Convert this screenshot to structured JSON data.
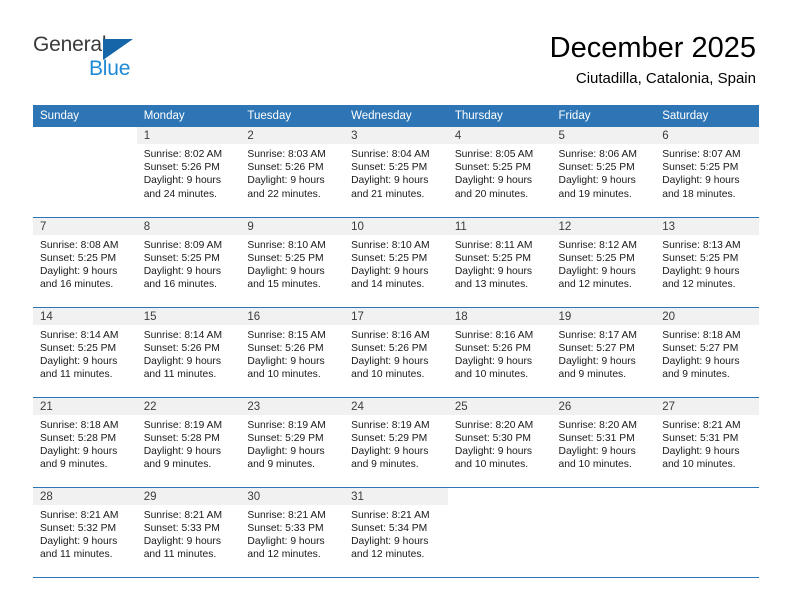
{
  "brand": {
    "name_part1": "General",
    "name_part2": "Blue",
    "triangle_icon": "triangle-icon",
    "accent_dark": "#1565a8",
    "accent_light": "#1f8ad6"
  },
  "header": {
    "month_title": "December 2025",
    "location": "Ciutadilla, Catalonia, Spain"
  },
  "theme": {
    "header_blue": "#2e75b6",
    "daynum_band": "#f1f1f1",
    "text": "#000000"
  },
  "weekday_headers": [
    "Sunday",
    "Monday",
    "Tuesday",
    "Wednesday",
    "Thursday",
    "Friday",
    "Saturday"
  ],
  "calendar": {
    "weeks": [
      [
        {
          "day": "",
          "sunrise": "",
          "sunset": "",
          "daylight_line1": "",
          "daylight_line2": "",
          "empty": true
        },
        {
          "day": "1",
          "sunrise": "Sunrise: 8:02 AM",
          "sunset": "Sunset: 5:26 PM",
          "daylight_line1": "Daylight: 9 hours",
          "daylight_line2": "and 24 minutes.",
          "empty": false
        },
        {
          "day": "2",
          "sunrise": "Sunrise: 8:03 AM",
          "sunset": "Sunset: 5:26 PM",
          "daylight_line1": "Daylight: 9 hours",
          "daylight_line2": "and 22 minutes.",
          "empty": false
        },
        {
          "day": "3",
          "sunrise": "Sunrise: 8:04 AM",
          "sunset": "Sunset: 5:25 PM",
          "daylight_line1": "Daylight: 9 hours",
          "daylight_line2": "and 21 minutes.",
          "empty": false
        },
        {
          "day": "4",
          "sunrise": "Sunrise: 8:05 AM",
          "sunset": "Sunset: 5:25 PM",
          "daylight_line1": "Daylight: 9 hours",
          "daylight_line2": "and 20 minutes.",
          "empty": false
        },
        {
          "day": "5",
          "sunrise": "Sunrise: 8:06 AM",
          "sunset": "Sunset: 5:25 PM",
          "daylight_line1": "Daylight: 9 hours",
          "daylight_line2": "and 19 minutes.",
          "empty": false
        },
        {
          "day": "6",
          "sunrise": "Sunrise: 8:07 AM",
          "sunset": "Sunset: 5:25 PM",
          "daylight_line1": "Daylight: 9 hours",
          "daylight_line2": "and 18 minutes.",
          "empty": false
        }
      ],
      [
        {
          "day": "7",
          "sunrise": "Sunrise: 8:08 AM",
          "sunset": "Sunset: 5:25 PM",
          "daylight_line1": "Daylight: 9 hours",
          "daylight_line2": "and 16 minutes.",
          "empty": false
        },
        {
          "day": "8",
          "sunrise": "Sunrise: 8:09 AM",
          "sunset": "Sunset: 5:25 PM",
          "daylight_line1": "Daylight: 9 hours",
          "daylight_line2": "and 16 minutes.",
          "empty": false
        },
        {
          "day": "9",
          "sunrise": "Sunrise: 8:10 AM",
          "sunset": "Sunset: 5:25 PM",
          "daylight_line1": "Daylight: 9 hours",
          "daylight_line2": "and 15 minutes.",
          "empty": false
        },
        {
          "day": "10",
          "sunrise": "Sunrise: 8:10 AM",
          "sunset": "Sunset: 5:25 PM",
          "daylight_line1": "Daylight: 9 hours",
          "daylight_line2": "and 14 minutes.",
          "empty": false
        },
        {
          "day": "11",
          "sunrise": "Sunrise: 8:11 AM",
          "sunset": "Sunset: 5:25 PM",
          "daylight_line1": "Daylight: 9 hours",
          "daylight_line2": "and 13 minutes.",
          "empty": false
        },
        {
          "day": "12",
          "sunrise": "Sunrise: 8:12 AM",
          "sunset": "Sunset: 5:25 PM",
          "daylight_line1": "Daylight: 9 hours",
          "daylight_line2": "and 12 minutes.",
          "empty": false
        },
        {
          "day": "13",
          "sunrise": "Sunrise: 8:13 AM",
          "sunset": "Sunset: 5:25 PM",
          "daylight_line1": "Daylight: 9 hours",
          "daylight_line2": "and 12 minutes.",
          "empty": false
        }
      ],
      [
        {
          "day": "14",
          "sunrise": "Sunrise: 8:14 AM",
          "sunset": "Sunset: 5:25 PM",
          "daylight_line1": "Daylight: 9 hours",
          "daylight_line2": "and 11 minutes.",
          "empty": false
        },
        {
          "day": "15",
          "sunrise": "Sunrise: 8:14 AM",
          "sunset": "Sunset: 5:26 PM",
          "daylight_line1": "Daylight: 9 hours",
          "daylight_line2": "and 11 minutes.",
          "empty": false
        },
        {
          "day": "16",
          "sunrise": "Sunrise: 8:15 AM",
          "sunset": "Sunset: 5:26 PM",
          "daylight_line1": "Daylight: 9 hours",
          "daylight_line2": "and 10 minutes.",
          "empty": false
        },
        {
          "day": "17",
          "sunrise": "Sunrise: 8:16 AM",
          "sunset": "Sunset: 5:26 PM",
          "daylight_line1": "Daylight: 9 hours",
          "daylight_line2": "and 10 minutes.",
          "empty": false
        },
        {
          "day": "18",
          "sunrise": "Sunrise: 8:16 AM",
          "sunset": "Sunset: 5:26 PM",
          "daylight_line1": "Daylight: 9 hours",
          "daylight_line2": "and 10 minutes.",
          "empty": false
        },
        {
          "day": "19",
          "sunrise": "Sunrise: 8:17 AM",
          "sunset": "Sunset: 5:27 PM",
          "daylight_line1": "Daylight: 9 hours",
          "daylight_line2": "and 9 minutes.",
          "empty": false
        },
        {
          "day": "20",
          "sunrise": "Sunrise: 8:18 AM",
          "sunset": "Sunset: 5:27 PM",
          "daylight_line1": "Daylight: 9 hours",
          "daylight_line2": "and 9 minutes.",
          "empty": false
        }
      ],
      [
        {
          "day": "21",
          "sunrise": "Sunrise: 8:18 AM",
          "sunset": "Sunset: 5:28 PM",
          "daylight_line1": "Daylight: 9 hours",
          "daylight_line2": "and 9 minutes.",
          "empty": false
        },
        {
          "day": "22",
          "sunrise": "Sunrise: 8:19 AM",
          "sunset": "Sunset: 5:28 PM",
          "daylight_line1": "Daylight: 9 hours",
          "daylight_line2": "and 9 minutes.",
          "empty": false
        },
        {
          "day": "23",
          "sunrise": "Sunrise: 8:19 AM",
          "sunset": "Sunset: 5:29 PM",
          "daylight_line1": "Daylight: 9 hours",
          "daylight_line2": "and 9 minutes.",
          "empty": false
        },
        {
          "day": "24",
          "sunrise": "Sunrise: 8:19 AM",
          "sunset": "Sunset: 5:29 PM",
          "daylight_line1": "Daylight: 9 hours",
          "daylight_line2": "and 9 minutes.",
          "empty": false
        },
        {
          "day": "25",
          "sunrise": "Sunrise: 8:20 AM",
          "sunset": "Sunset: 5:30 PM",
          "daylight_line1": "Daylight: 9 hours",
          "daylight_line2": "and 10 minutes.",
          "empty": false
        },
        {
          "day": "26",
          "sunrise": "Sunrise: 8:20 AM",
          "sunset": "Sunset: 5:31 PM",
          "daylight_line1": "Daylight: 9 hours",
          "daylight_line2": "and 10 minutes.",
          "empty": false
        },
        {
          "day": "27",
          "sunrise": "Sunrise: 8:21 AM",
          "sunset": "Sunset: 5:31 PM",
          "daylight_line1": "Daylight: 9 hours",
          "daylight_line2": "and 10 minutes.",
          "empty": false
        }
      ],
      [
        {
          "day": "28",
          "sunrise": "Sunrise: 8:21 AM",
          "sunset": "Sunset: 5:32 PM",
          "daylight_line1": "Daylight: 9 hours",
          "daylight_line2": "and 11 minutes.",
          "empty": false
        },
        {
          "day": "29",
          "sunrise": "Sunrise: 8:21 AM",
          "sunset": "Sunset: 5:33 PM",
          "daylight_line1": "Daylight: 9 hours",
          "daylight_line2": "and 11 minutes.",
          "empty": false
        },
        {
          "day": "30",
          "sunrise": "Sunrise: 8:21 AM",
          "sunset": "Sunset: 5:33 PM",
          "daylight_line1": "Daylight: 9 hours",
          "daylight_line2": "and 12 minutes.",
          "empty": false
        },
        {
          "day": "31",
          "sunrise": "Sunrise: 8:21 AM",
          "sunset": "Sunset: 5:34 PM",
          "daylight_line1": "Daylight: 9 hours",
          "daylight_line2": "and 12 minutes.",
          "empty": false
        },
        {
          "day": "",
          "sunrise": "",
          "sunset": "",
          "daylight_line1": "",
          "daylight_line2": "",
          "empty": true
        },
        {
          "day": "",
          "sunrise": "",
          "sunset": "",
          "daylight_line1": "",
          "daylight_line2": "",
          "empty": true
        },
        {
          "day": "",
          "sunrise": "",
          "sunset": "",
          "daylight_line1": "",
          "daylight_line2": "",
          "empty": true
        }
      ]
    ]
  }
}
